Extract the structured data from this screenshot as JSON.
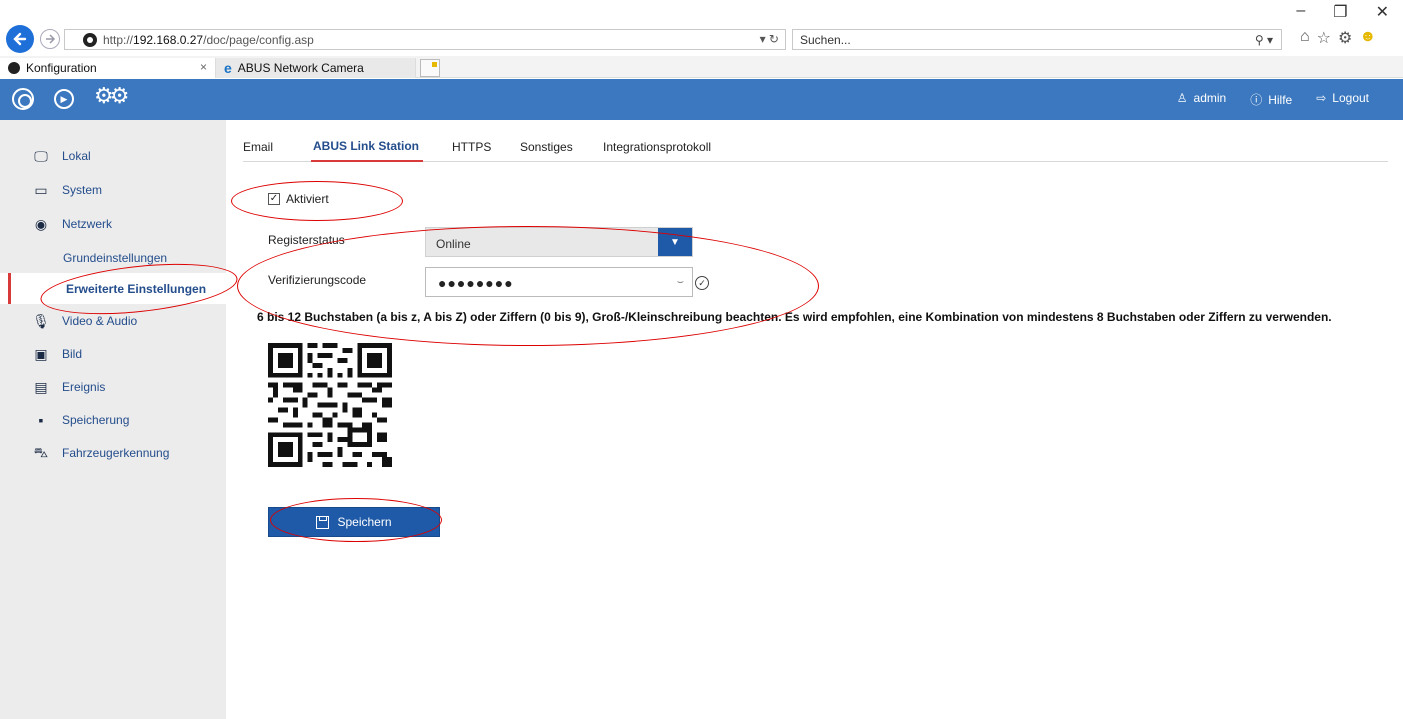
{
  "browser": {
    "address": "http://192.168.0.27/doc/page/config.asp",
    "address_host": "192.168.0.27",
    "address_prefix": "http://",
    "address_path": "/doc/page/config.asp",
    "address_right": "▾ ↻",
    "search_placeholder": "Suchen...",
    "tabs": [
      {
        "title": "Konfiguration",
        "close": "×"
      },
      {
        "title": "ABUS Network Camera"
      }
    ],
    "window_controls": [
      "–",
      "❐",
      "✕"
    ]
  },
  "header": {
    "user": "admin",
    "help": "Hilfe",
    "logout": "Logout"
  },
  "sidebar": {
    "items": [
      {
        "label": "Lokal",
        "icon": "monitor-icon"
      },
      {
        "label": "System",
        "icon": "window-icon"
      },
      {
        "label": "Netzwerk",
        "icon": "globe-icon"
      },
      {
        "label": "Grundeinstellungen",
        "sub": true
      },
      {
        "label": "Erweiterte Einstellungen",
        "sub": true,
        "active": true
      },
      {
        "label": "Video & Audio",
        "icon": "microphone-icon"
      },
      {
        "label": "Bild",
        "icon": "image-icon"
      },
      {
        "label": "Ereignis",
        "icon": "calendar-icon"
      },
      {
        "label": "Speicherung",
        "icon": "save-icon"
      },
      {
        "label": "Fahrzeugerkennung",
        "icon": "car-search-icon"
      }
    ]
  },
  "content_tabs": [
    {
      "label": "Email"
    },
    {
      "label": "ABUS Link Station",
      "active": true
    },
    {
      "label": "HTTPS"
    },
    {
      "label": "Sonstiges"
    },
    {
      "label": "Integrationsprotokoll"
    }
  ],
  "form": {
    "enabled_label": "Aktiviert",
    "enabled": true,
    "checkmark": "✓",
    "status_label": "Registerstatus",
    "status_value": "Online",
    "code_label": "Verifizierungscode",
    "code_value": "●●●●●●●●",
    "hint": "6 bis 12 Buchstaben (a bis z, A bis Z) oder Ziffern (0 bis 9), Groß-/Kleinschreibung beachten. Es wird empfohlen, eine Kombination von mindestens 8 Buchstaben oder Ziffern zu verwenden.",
    "save_label": "Speichern"
  },
  "colors": {
    "header": "#3b78bf",
    "button": "#1e5aa8",
    "accent_red": "#d83a3a",
    "sidebar_bg": "#ececec"
  }
}
